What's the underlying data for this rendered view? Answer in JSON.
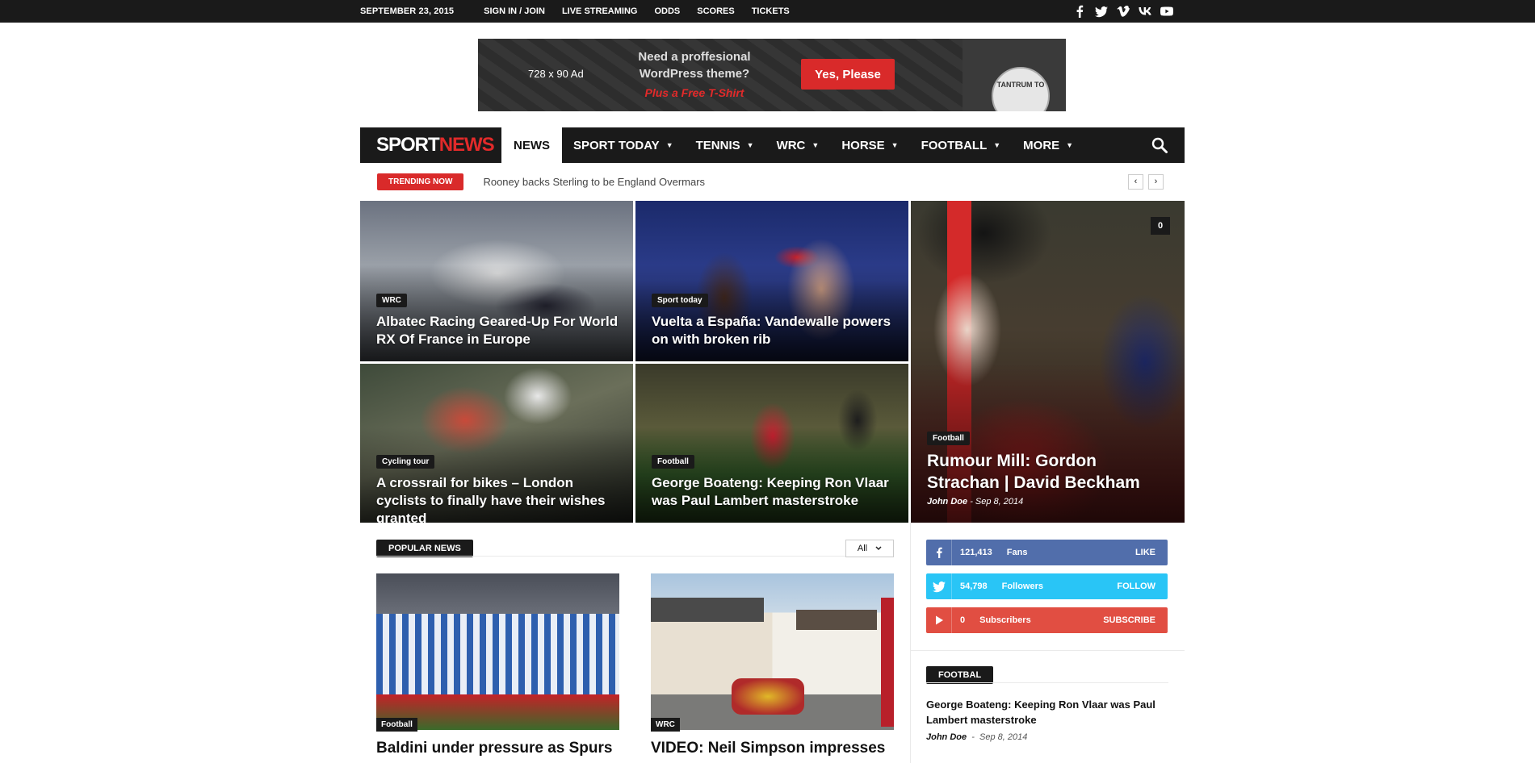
{
  "topbar": {
    "date": "SEPTEMBER 23, 2015",
    "links": [
      "SIGN IN / JOIN",
      "LIVE STREAMING",
      "ODDS",
      "SCORES",
      "TICKETS"
    ],
    "socials": [
      "facebook-icon",
      "twitter-icon",
      "vimeo-icon",
      "vk-icon",
      "youtube-icon"
    ]
  },
  "ad": {
    "size": "728 x 90 Ad",
    "line1": "Need a proffesional",
    "line2": "WordPress theme?",
    "free": "Plus a Free T-Shirt",
    "button": "Yes, Please",
    "shirt_brand": "TANTRUM TO"
  },
  "logo": {
    "part1": "SPORT",
    "part2": "NEWS"
  },
  "nav": {
    "items": [
      {
        "label": "NEWS",
        "active": true,
        "dropdown": false
      },
      {
        "label": "SPORT TODAY",
        "dropdown": true
      },
      {
        "label": "TENNIS",
        "dropdown": true
      },
      {
        "label": "WRC",
        "dropdown": true
      },
      {
        "label": "HORSE",
        "dropdown": true
      },
      {
        "label": "FOOTBALL",
        "dropdown": true
      },
      {
        "label": "MORE",
        "dropdown": true
      }
    ],
    "chevron": "▼"
  },
  "trending": {
    "badge": "TRENDING NOW",
    "headline": "Rooney backs Sterling to be England Overmars",
    "prev": "‹",
    "next": "›"
  },
  "hero": {
    "tiles": [
      {
        "category": "WRC",
        "title": "Albatec Racing Geared-Up For World RX Of France in Europe"
      },
      {
        "category": "Sport today",
        "title": "Vuelta a España: Vandewalle powers on with broken rib"
      },
      {
        "category": "Cycling tour",
        "title": "A crossrail for bikes – London cyclists to finally have their wishes granted"
      },
      {
        "category": "Football",
        "title": "George Boateng: Keeping Ron Vlaar was Paul Lambert masterstroke"
      }
    ],
    "big": {
      "category": "Football",
      "title": "Rumour Mill: Gordon Strachan | David Beckham",
      "author": "John Doe",
      "sep": "-",
      "date": "Sep 8, 2014",
      "comments": "0"
    }
  },
  "popular": {
    "heading": "POPULAR NEWS",
    "filter": "All",
    "cards": [
      {
        "category": "Football",
        "title": "Baldini under pressure as Spurs"
      },
      {
        "category": "WRC",
        "title": "VIDEO: Neil Simpson impresses"
      }
    ]
  },
  "social_counters": {
    "facebook": {
      "count": "121,413",
      "label": "Fans",
      "action": "LIKE"
    },
    "twitter": {
      "count": "54,798",
      "label": "Followers",
      "action": "FOLLOW"
    },
    "youtube": {
      "count": "0",
      "label": "Subscribers",
      "action": "SUBSCRIBE"
    }
  },
  "sidebar_football": {
    "heading": "FOOTBAL",
    "title": "George Boateng: Keeping Ron Vlaar was Paul Lambert masterstroke",
    "author": "John Doe",
    "sep": "-",
    "date": "Sep 8, 2014"
  },
  "colors": {
    "accent": "#e22a2a",
    "dark": "#1a1a1a",
    "facebook": "#516eab",
    "twitter": "#29c5f6",
    "youtube": "#e14e42"
  }
}
